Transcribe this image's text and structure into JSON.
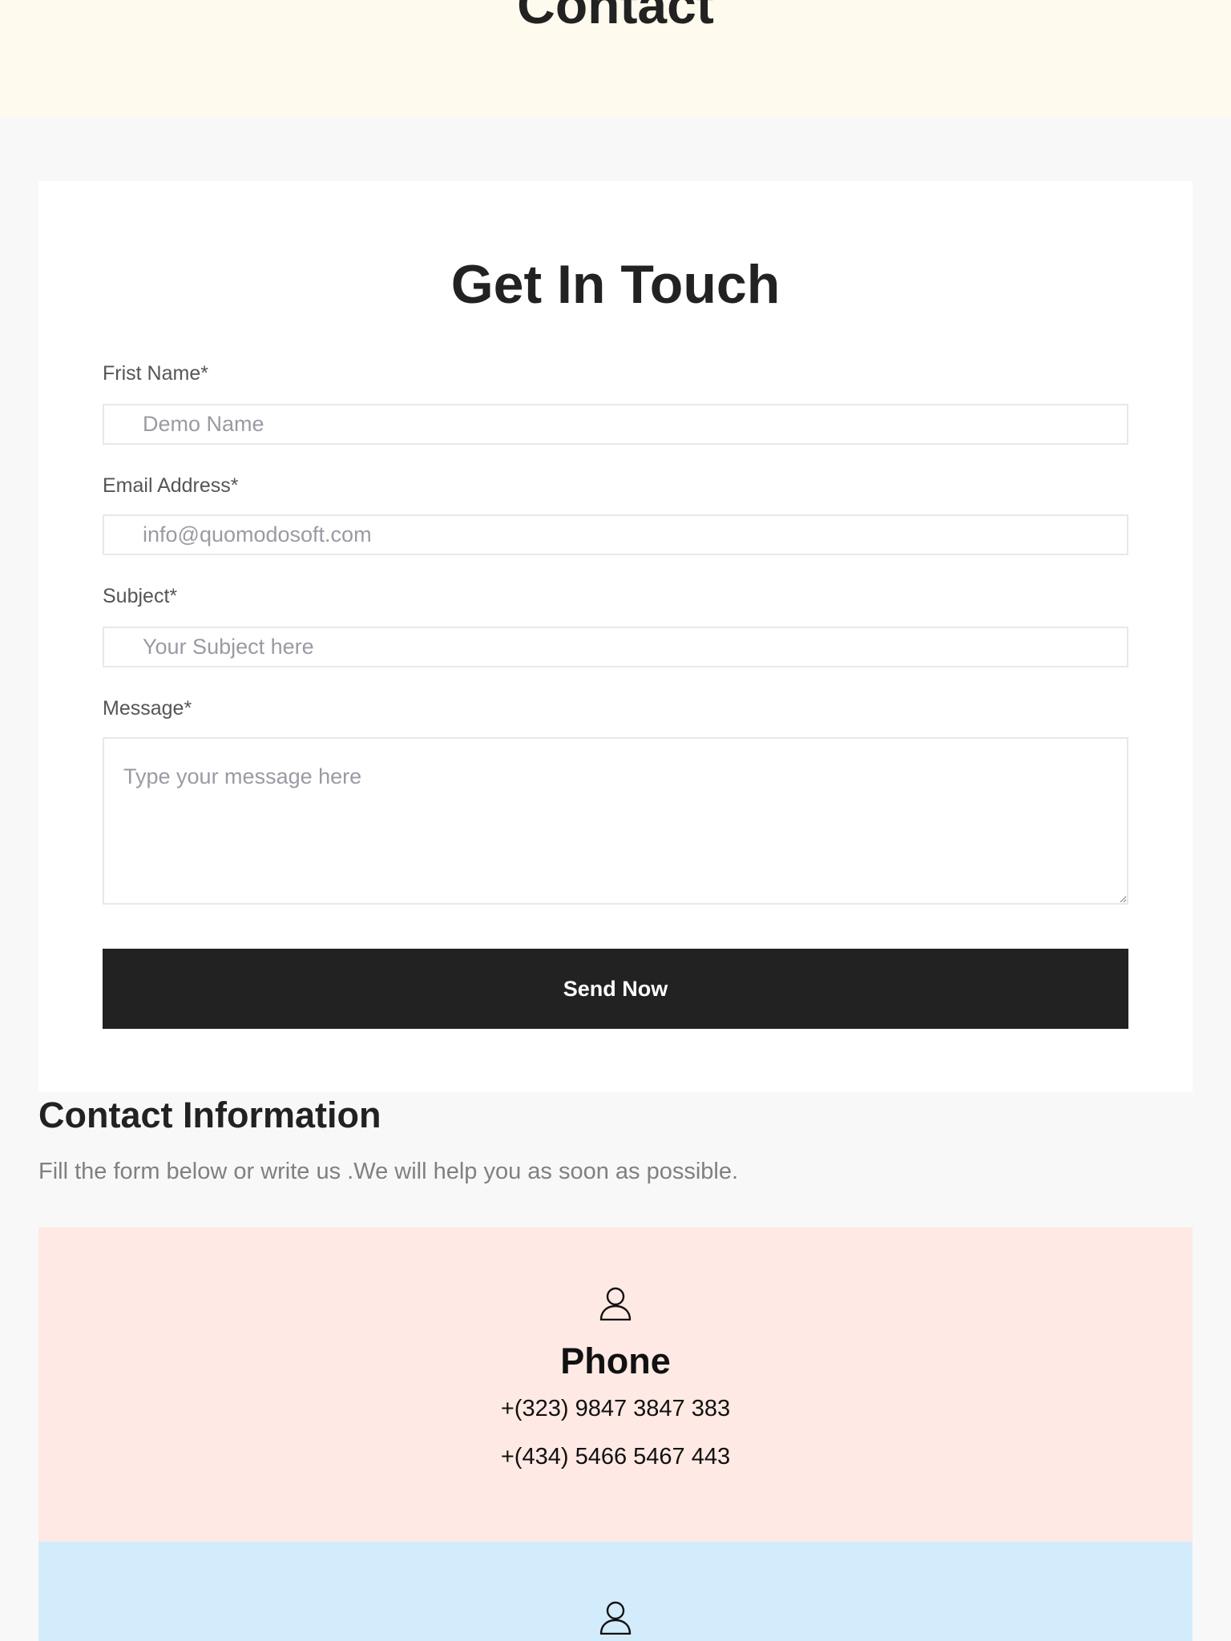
{
  "hero": {
    "title": "Contact",
    "background": "#fffaee"
  },
  "form": {
    "title": "Get In Touch",
    "fields": [
      {
        "label": "Frist Name*",
        "placeholder": "Demo Name"
      },
      {
        "label": "Email Address*",
        "placeholder": "info@quomodosoft.com"
      },
      {
        "label": "Subject*",
        "placeholder": "Your Subject here"
      }
    ],
    "message": {
      "label": "Message*",
      "placeholder": "Type your message here"
    },
    "submit_label": "Send Now"
  },
  "contact_info": {
    "title": "Contact Information",
    "subtitle": "Fill the form below or write us .We will help you as soon as possible.",
    "boxes": [
      {
        "icon": "user-icon",
        "title": "Phone",
        "lines": [
          "+(323) 9847 3847 383",
          "+(434) 5466 5467 443"
        ],
        "background": "#ffe9e4"
      },
      {
        "icon": "user-icon",
        "background": "#d3ecfc"
      }
    ]
  },
  "colors": {
    "page_background": "#f8f8f8",
    "card_background": "#ffffff",
    "button_background": "#222222",
    "button_text": "#ffffff"
  }
}
